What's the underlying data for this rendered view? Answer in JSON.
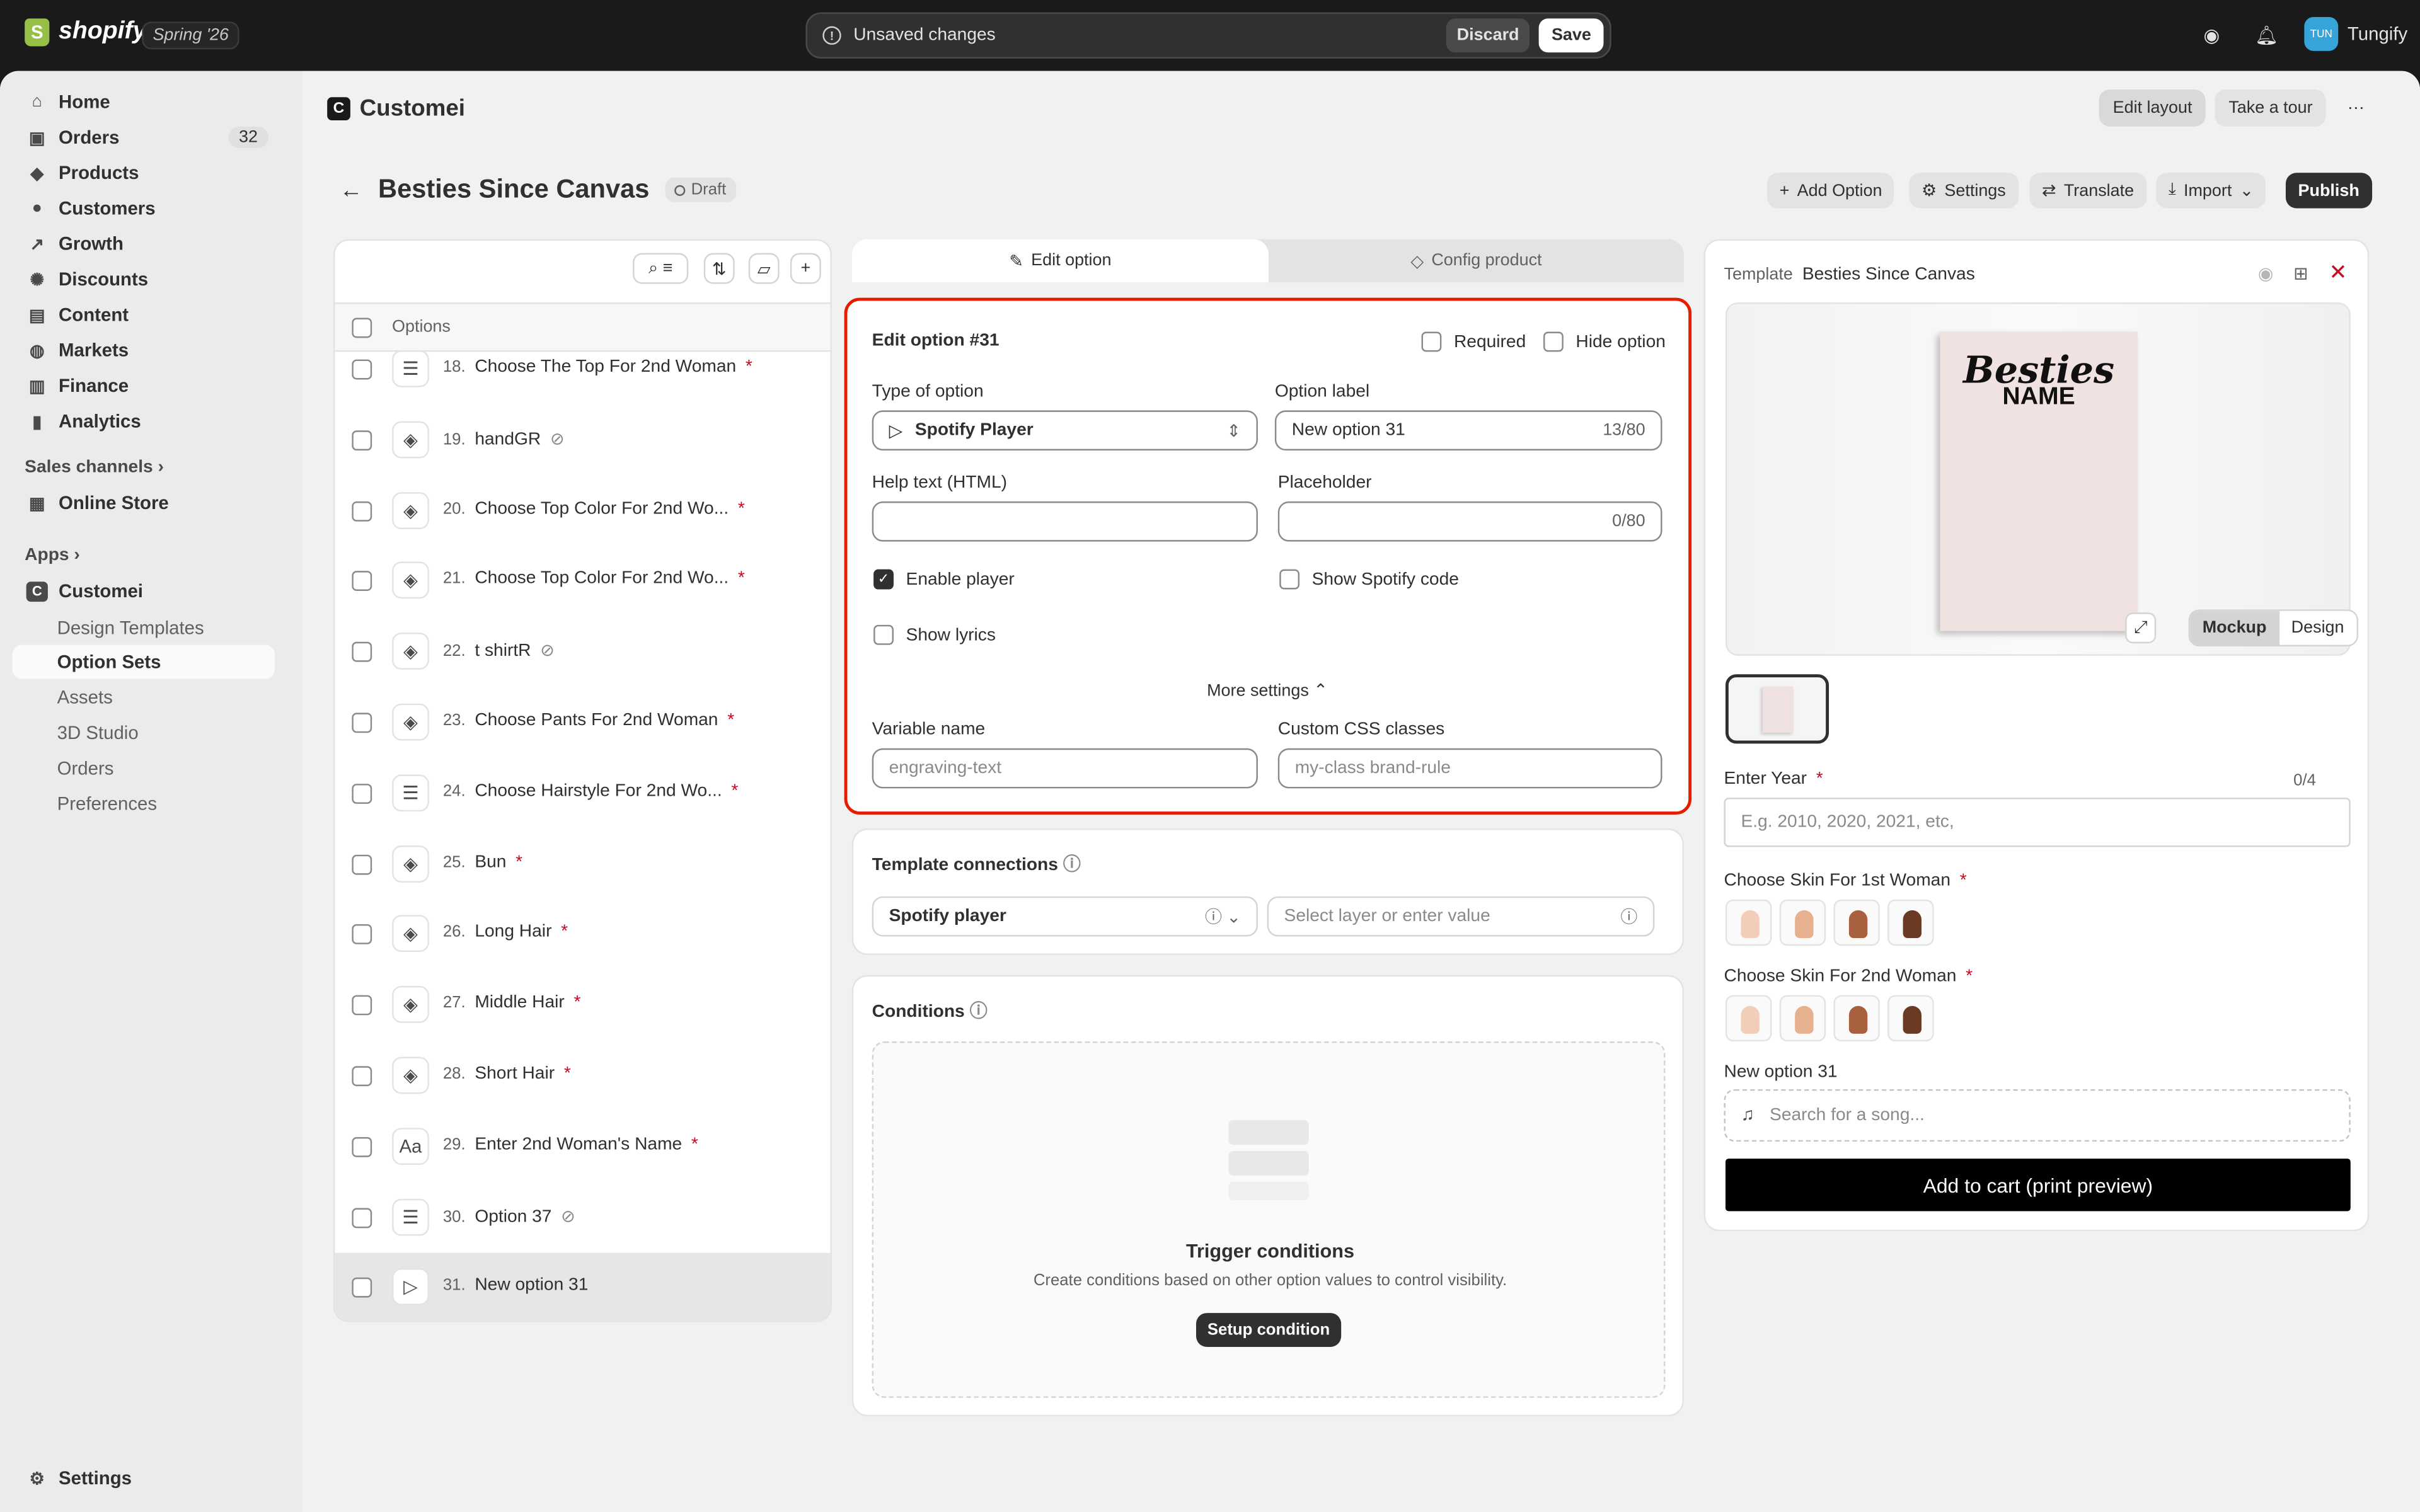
{
  "topbar": {
    "brand": "shopify",
    "edition": "Spring '26",
    "unsaved": "Unsaved changes",
    "discard": "Discard",
    "save": "Save",
    "avatar": "TUN",
    "user": "Tungify"
  },
  "nav": {
    "items": [
      {
        "label": "Home",
        "icon": "home-icon"
      },
      {
        "label": "Orders",
        "icon": "orders-icon",
        "count": "32"
      },
      {
        "label": "Products",
        "icon": "tag-icon"
      },
      {
        "label": "Customers",
        "icon": "person-icon"
      },
      {
        "label": "Growth",
        "icon": "growth-icon"
      },
      {
        "label": "Discounts",
        "icon": "discount-icon"
      },
      {
        "label": "Content",
        "icon": "content-icon"
      },
      {
        "label": "Markets",
        "icon": "globe-icon"
      },
      {
        "label": "Finance",
        "icon": "bank-icon"
      },
      {
        "label": "Analytics",
        "icon": "chart-icon"
      }
    ],
    "sales_channels": "Sales channels",
    "online_store": "Online Store",
    "apps": "Apps",
    "app_name": "Customei",
    "app_items": [
      "Design Templates",
      "Option Sets",
      "Assets",
      "3D Studio",
      "Orders",
      "Preferences"
    ],
    "settings": "Settings"
  },
  "app": {
    "name": "Customei",
    "edit_layout": "Edit layout",
    "tour": "Take a tour",
    "more": "···"
  },
  "page": {
    "title": "Besties Since Canvas",
    "status": "Draft",
    "add_option": "Add Option",
    "settings": "Settings",
    "translate": "Translate",
    "import": "Import",
    "publish": "Publish"
  },
  "list": {
    "header": "Options",
    "rows": [
      {
        "num": "18.",
        "label": "Choose The Top For 2nd Woman",
        "icon": "list-icon",
        "req": true,
        "hidden": false
      },
      {
        "num": "19.",
        "label": "handGR",
        "icon": "paint-icon",
        "req": false,
        "hidden": true
      },
      {
        "num": "20.",
        "label": "Choose Top Color For 2nd Wo...",
        "icon": "paint-icon",
        "req": true,
        "hidden": false
      },
      {
        "num": "21.",
        "label": "Choose Top Color For 2nd Wo...",
        "icon": "paint-icon",
        "req": true,
        "hidden": false
      },
      {
        "num": "22.",
        "label": "t shirtR",
        "icon": "paint-icon",
        "req": false,
        "hidden": true
      },
      {
        "num": "23.",
        "label": "Choose Pants For 2nd Woman",
        "icon": "paint-icon",
        "req": true,
        "hidden": false
      },
      {
        "num": "24.",
        "label": "Choose Hairstyle For 2nd Wo...",
        "icon": "list-icon",
        "req": true,
        "hidden": false
      },
      {
        "num": "25.",
        "label": "Bun",
        "icon": "paint-icon",
        "req": true,
        "hidden": false
      },
      {
        "num": "26.",
        "label": "Long Hair",
        "icon": "paint-icon",
        "req": true,
        "hidden": false
      },
      {
        "num": "27.",
        "label": "Middle Hair",
        "icon": "paint-icon",
        "req": true,
        "hidden": false
      },
      {
        "num": "28.",
        "label": "Short Hair",
        "icon": "paint-icon",
        "req": true,
        "hidden": false
      },
      {
        "num": "29.",
        "label": "Enter 2nd Woman's Name",
        "icon": "text-icon",
        "req": true,
        "hidden": false
      },
      {
        "num": "30.",
        "label": "Option 37",
        "icon": "list-icon",
        "req": false,
        "hidden": true
      },
      {
        "num": "31.",
        "label": "New option 31",
        "icon": "play-icon",
        "req": false,
        "hidden": false,
        "selected": true
      }
    ]
  },
  "editor": {
    "tab_edit": "Edit option",
    "tab_config": "Config product",
    "heading": "Edit option #31",
    "required": "Required",
    "hide_option": "Hide option",
    "type_label": "Type of option",
    "type_value": "Spotify Player",
    "option_label": "Option label",
    "option_value": "New option 31",
    "option_count": "13/80",
    "help_label": "Help text (HTML)",
    "placeholder_label": "Placeholder",
    "placeholder_count": "0/80",
    "enable_player": "Enable player",
    "enable_player_checked": true,
    "show_code": "Show Spotify code",
    "show_lyrics": "Show lyrics",
    "more_settings": "More settings",
    "variable_label": "Variable name",
    "variable_ph": "engraving-text",
    "css_label": "Custom CSS classes",
    "css_ph": "my-class brand-rule"
  },
  "connections": {
    "title": "Template connections",
    "select": "Spotify player",
    "layer_ph": "Select layer or enter value"
  },
  "conditions": {
    "title": "Conditions",
    "empty_title": "Trigger conditions",
    "empty_desc": "Create conditions based on other option values to control visibility.",
    "button": "Setup condition"
  },
  "preview": {
    "template_label": "Template",
    "template_name": "Besties Since Canvas",
    "canvas_text1": "Besties",
    "canvas_text2": "NAME",
    "mockup": "Mockup",
    "design": "Design",
    "year_label": "Enter Year",
    "year_count": "0/4",
    "year_ph": "E.g. 2010, 2020, 2021, etc,",
    "skin1": "Choose Skin For 1st Woman",
    "skin2": "Choose Skin For 2nd Woman",
    "skin_colors": [
      "#f2cdb8",
      "#e7b190",
      "#a8603f",
      "#6b3a24"
    ],
    "new_option": "New option 31",
    "song_ph": "Search for a song...",
    "cart": "Add to cart (print preview)"
  },
  "colors": {
    "highlight": "#e51c00",
    "required": "#c70a24",
    "primary": "#303030"
  }
}
